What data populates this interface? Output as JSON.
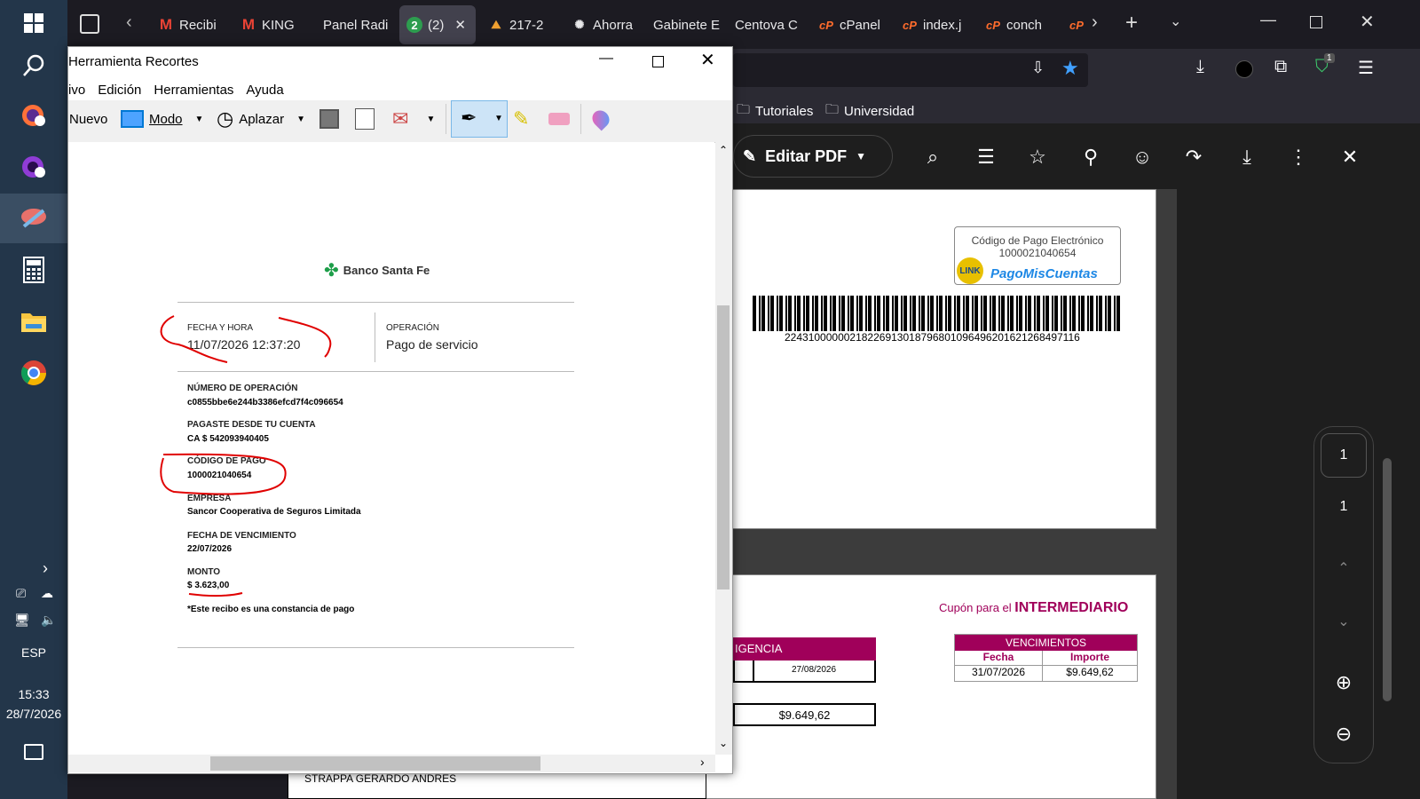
{
  "taskbar": {
    "lang": "ESP",
    "time": "15:33",
    "date": "28/7/2026"
  },
  "browser": {
    "tabs": [
      {
        "label": "Recibi",
        "icon": "gmail-icon"
      },
      {
        "label": "KING",
        "icon": "gmail-icon"
      },
      {
        "label": "Panel Radi",
        "icon": ""
      },
      {
        "label": "(2)",
        "icon": "badge",
        "badge": "2"
      },
      {
        "label": "217-2",
        "icon": "mountain-icon"
      },
      {
        "label": "Ahorra",
        "icon": "openai-icon"
      },
      {
        "label": "Gabinete E",
        "icon": ""
      },
      {
        "label": "Centova C",
        "icon": ""
      },
      {
        "label": "cPanel",
        "icon": "cpanel-icon"
      },
      {
        "label": "index.j",
        "icon": "cpanel-icon"
      },
      {
        "label": "conch",
        "icon": "cpanel-icon"
      }
    ],
    "bookmarks": [
      "Tutoriales",
      "Universidad"
    ],
    "ext_badge": "1"
  },
  "pdf": {
    "edit_label": "Editar PDF",
    "codigo_title": "Código de Pago Electrónico",
    "codigo_num": "1000021040654",
    "link_logo": "LINK",
    "pmc_logo": "PagoMisCuentas",
    "barcode_num": "22431000000218226913018796801096496201621268497116",
    "cupon_prefix": "Cupón para el",
    "cupon_strong": "INTERMEDIARIO",
    "vigencia": "IGENCIA",
    "vig_date": "27/08/2026",
    "amount": "$9.649,62",
    "venc_title": "VENCIMIENTOS",
    "venc_col1": "Fecha",
    "venc_col2": "Importe",
    "venc_date": "31/07/2026",
    "venc_amount": "$9.649,62",
    "name": "STRAPPA GERARDO ANDRES",
    "page_current": "1",
    "page_total": "1"
  },
  "snip": {
    "title": "Herramienta Recortes",
    "menu": [
      "ivo",
      "Edición",
      "Herramientas",
      "Ayuda"
    ],
    "nuevo": "Nuevo",
    "modo": "Modo",
    "aplazar": "Aplazar"
  },
  "receipt": {
    "bank": "Banco Santa Fe",
    "fecha_lbl": "FECHA Y HORA",
    "fecha": "11/07/2026 12:37:20",
    "op_lbl": "OPERACIÓN",
    "op": "Pago de servicio",
    "num_lbl": "NÚMERO DE OPERACIÓN",
    "num": "c0855bbe6e244b3386efcd7f4c096654",
    "cuenta_lbl": "PAGASTE DESDE TU CUENTA",
    "cuenta": "CA $ 542093940405",
    "codigo_lbl": "CÓDIGO DE PAGO",
    "codigo": "1000021040654",
    "empresa_lbl": "EMPRESA",
    "empresa": "Sancor Cooperativa de Seguros Limitada",
    "venc_lbl": "FECHA DE VENCIMIENTO",
    "venc": "22/07/2026",
    "monto_lbl": "MONTO",
    "monto": "$ 3.623,00",
    "nota": "*Este recibo es una constancia de pago"
  },
  "colors": {
    "accent": "#0078d4",
    "annot": "#e00000",
    "magenta": "#a0005a"
  }
}
